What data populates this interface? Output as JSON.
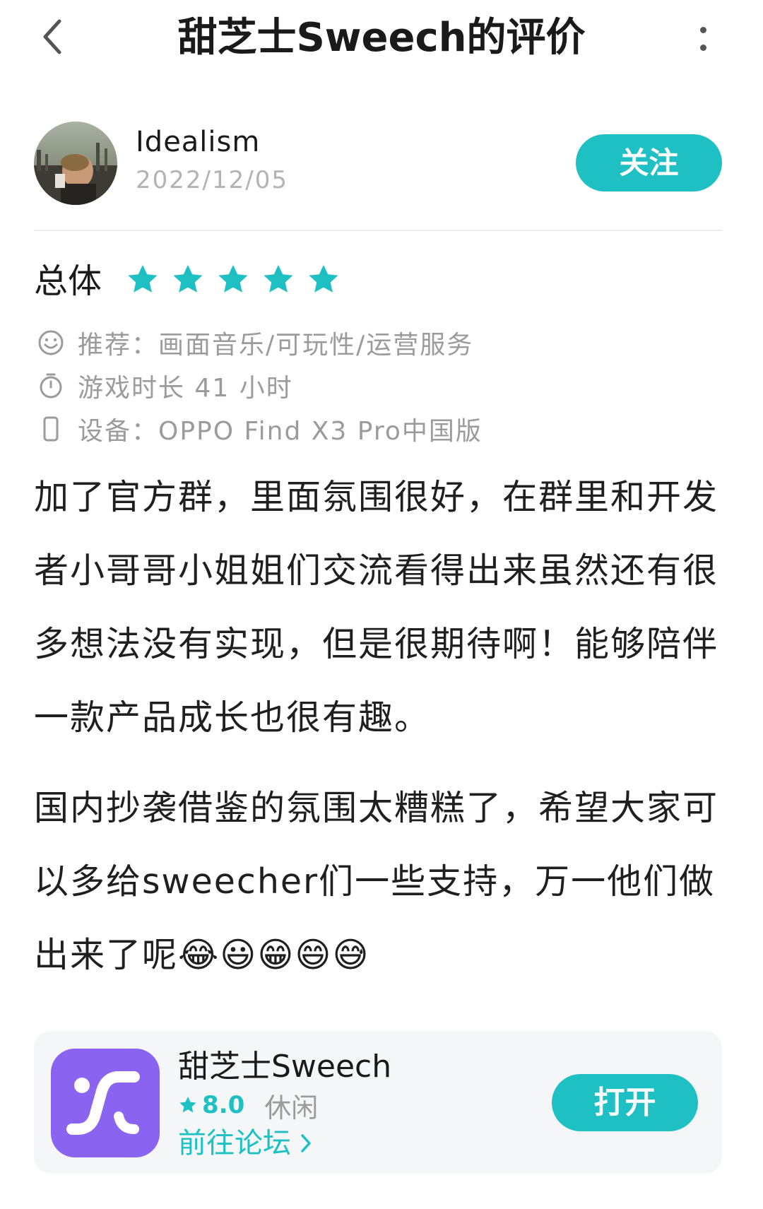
{
  "header": {
    "title": "甜芝士Sweech的评价",
    "back_icon": "chevron-left-icon",
    "more_icon": "more-vertical-icon"
  },
  "user": {
    "name": "Idealism",
    "date": "2022/12/05",
    "follow_label": "关注"
  },
  "rating": {
    "overall_label": "总体",
    "stars": 5,
    "max_stars": 5
  },
  "meta": {
    "recommend": "推荐：画面音乐/可玩性/运营服务",
    "playtime": "游戏时长 41 小时",
    "device": "设备：OPPO Find X3 Pro中国版"
  },
  "review": {
    "paragraph_1": "加了官方群，里面氛围很好，在群里和开发者小哥哥小姐姐们交流看得出来虽然还有很多想法没有实现，但是很期待啊！能够陪伴一款产品成长也很有趣。",
    "paragraph_2": "国内抄袭借鉴的氛围太糟糕了，希望大家可以多给sweecher们一些支持，万一他们做出来了呢😂😃😁😄😅"
  },
  "app_card": {
    "name": "甜芝士Sweech",
    "rating": "8.0",
    "category": "休闲",
    "forum_link": "前往论坛",
    "open_label": "打开"
  },
  "colors": {
    "accent": "#1fc0c4",
    "app_icon_bg": "#8a63f0",
    "meta_text": "#9b9b9b",
    "card_bg": "#f5f6f7"
  }
}
